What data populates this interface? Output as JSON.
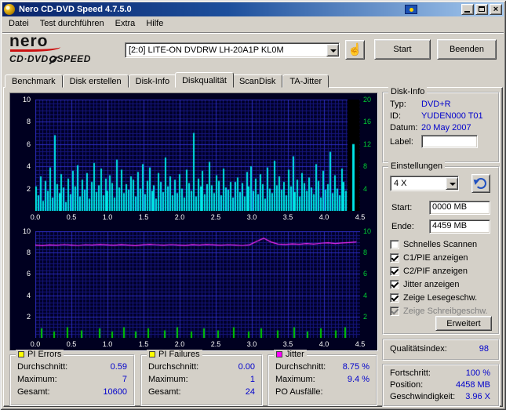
{
  "window": {
    "title": "Nero CD-DVD Speed 4.7.5.0"
  },
  "menu": {
    "items": [
      "Datei",
      "Test durchführen",
      "Extra",
      "Hilfe"
    ]
  },
  "toolbar": {
    "logo": {
      "line1": "nero",
      "line2_left": "CD·DVD",
      "line2_right": "SPEED"
    },
    "drive": "[2:0]  LITE-ON DVDRW LH-20A1P KL0M",
    "start": "Start",
    "quit": "Beenden"
  },
  "tabs": {
    "items": [
      "Benchmark",
      "Disk erstellen",
      "Disk-Info",
      "Diskqualität",
      "ScanDisk",
      "TA-Jitter"
    ],
    "active": "Diskqualität"
  },
  "disk_info": {
    "title": "Disk-Info",
    "rows": [
      {
        "label": "Typ:",
        "value": "DVD+R"
      },
      {
        "label": "ID:",
        "value": "YUDEN000 T01"
      },
      {
        "label": "Datum:",
        "value": "20 May 2007"
      },
      {
        "label": "Label:",
        "value": ""
      }
    ]
  },
  "settings": {
    "title": "Einstellungen",
    "speed_value": "4 X",
    "start_label": "Start:",
    "start_value": "0000 MB",
    "end_label": "Ende:",
    "end_value": "4459 MB",
    "checkboxes": [
      {
        "label": "Schnelles Scannen",
        "checked": false,
        "disabled": false
      },
      {
        "label": "C1/PIE anzeigen",
        "checked": true,
        "disabled": false
      },
      {
        "label": "C2/PIF anzeigen",
        "checked": true,
        "disabled": false
      },
      {
        "label": "Jitter anzeigen",
        "checked": true,
        "disabled": false
      },
      {
        "label": "Zeige Lesegeschw.",
        "checked": true,
        "disabled": false
      },
      {
        "label": "Zeige Schreibgeschw.",
        "checked": true,
        "disabled": true
      }
    ],
    "advanced": "Erweitert"
  },
  "quality_index": {
    "label": "Qualitätsindex:",
    "value": "98"
  },
  "progress": {
    "rows": [
      {
        "label": "Fortschritt:",
        "value": "100 %"
      },
      {
        "label": "Position:",
        "value": "4458 MB"
      },
      {
        "label": "Geschwindigkeit:",
        "value": "3.96 X"
      }
    ]
  },
  "stats": {
    "pi_errors": {
      "title": "PI Errors",
      "color": "#ffff00",
      "rows": [
        {
          "label": "Durchschnitt:",
          "value": "0.59"
        },
        {
          "label": "Maximum:",
          "value": "7"
        },
        {
          "label": "Gesamt:",
          "value": "10600"
        }
      ]
    },
    "pi_failures": {
      "title": "PI Failures",
      "color": "#ffff00",
      "rows": [
        {
          "label": "Durchschnitt:",
          "value": "0.00"
        },
        {
          "label": "Maximum:",
          "value": "1"
        },
        {
          "label": "Gesamt:",
          "value": "24"
        }
      ]
    },
    "jitter": {
      "title": "Jitter",
      "color": "#ff00ff",
      "rows": [
        {
          "label": "Durchschnitt:",
          "value": "8.75 %"
        },
        {
          "label": "Maximum:",
          "value": "9.4 %"
        },
        {
          "label": "PO Ausfälle:",
          "value": ""
        }
      ]
    }
  },
  "chart_data": [
    {
      "type": "bar",
      "title": "PI Errors vs. Disk-Position (GB)",
      "xlim": [
        0,
        4.5
      ],
      "ylim": [
        0,
        10
      ],
      "x_ticks": [
        "0.0",
        "0.5",
        "1.0",
        "1.5",
        "2.0",
        "2.5",
        "3.0",
        "3.5",
        "4.0",
        "4.5"
      ],
      "y_ticks_left": [
        "10",
        "8",
        "6",
        "4",
        "2"
      ],
      "y_ticks_right": [
        "20",
        "16",
        "12",
        "8",
        "4"
      ],
      "grid": {
        "bg": "#000026",
        "minor": "#16167d",
        "major": "#2b2bbd"
      },
      "bar_color": "#00e6e6",
      "bars_end_x": 4.33,
      "values": [
        2.2,
        1.4,
        3.1,
        0.9,
        2.7,
        1.8,
        3.9,
        1.2,
        6.8,
        2.4,
        1.6,
        3.3,
        2.1,
        0.8,
        2.9,
        1.5,
        3.6,
        2.2,
        4.1,
        1.3,
        2.8,
        1.9,
        3.4,
        1.1,
        2.6,
        4.3,
        1.7,
        2.3,
        3.8,
        1.4,
        2.9,
        1.8,
        3.2,
        2.5,
        1.2,
        4.6,
        2.1,
        3.7,
        1.6,
        2.4,
        1.9,
        3.1,
        2.8,
        1.3,
        3.5,
        2.0,
        4.2,
        1.5,
        2.7,
        3.9,
        1.8,
        2.3,
        1.1,
        3.4,
        2.6,
        1.7,
        4.8,
        2.2,
        3.1,
        1.4,
        2.8,
        1.6,
        3.3,
        2.0,
        1.2,
        3.7,
        2.5,
        1.8,
        7.0,
        1.3,
        2.9,
        2.2,
        3.6,
        1.5,
        2.4,
        4.4,
        2.3,
        1.6,
        3.2,
        2.7,
        1.4,
        3.8,
        2.1,
        1.9,
        2.6,
        1.2,
        2.6,
        3.0,
        1.7,
        2.5,
        1.3,
        3.5,
        2.2,
        4.0,
        1.8,
        2.9,
        1.5,
        3.3,
        2.4,
        1.1,
        3.9,
        2.0,
        1.6,
        4.5,
        2.3,
        3.1,
        1.9,
        2.6,
        1.4,
        3.7,
        2.2,
        4.9,
        1.7,
        2.8,
        1.3,
        3.4,
        2.5,
        1.8,
        3.0,
        2.1,
        1.5,
        4.2,
        2.7,
        1.2,
        3.6,
        1.9,
        2.4,
        5.3,
        1.6,
        3.2,
        2.0,
        1.4,
        3.8,
        2.6,
        1.8
      ],
      "tail": {
        "black_from": 4.33,
        "spike_x": 4.39,
        "spike_value": 6
      }
    },
    {
      "type": "bar+line",
      "title": "PI Failures und Jitter vs. Disk-Position (GB)",
      "xlim": [
        0,
        4.5
      ],
      "ylim": [
        0,
        10
      ],
      "x_ticks": [
        "0.0",
        "0.5",
        "1.0",
        "1.5",
        "2.0",
        "2.5",
        "3.0",
        "3.5",
        "4.0",
        "4.5"
      ],
      "y_ticks_left": [
        "10",
        "8",
        "6",
        "4",
        "2"
      ],
      "y_ticks_right": [
        "10",
        "8",
        "6",
        "4",
        "2"
      ],
      "grid": {
        "bg": "#000026",
        "minor": "#16167d",
        "major": "#2b2bbd"
      },
      "bar_color": "#00cc00",
      "line_color": "#ff2bff",
      "pif_spikes": [
        [
          0.08,
          0.9
        ],
        [
          0.25,
          0.6
        ],
        [
          0.44,
          1.0
        ],
        [
          0.63,
          0.7
        ],
        [
          0.88,
          0.9
        ],
        [
          1.05,
          0.6
        ],
        [
          1.22,
          1.0
        ],
        [
          1.38,
          0.6
        ],
        [
          1.55,
          0.9
        ],
        [
          1.78,
          0.7
        ],
        [
          1.96,
          1.0
        ],
        [
          2.15,
          0.6
        ],
        [
          2.33,
          0.9
        ],
        [
          2.52,
          0.7
        ],
        [
          2.74,
          1.0
        ],
        [
          2.95,
          0.6
        ],
        [
          3.12,
          0.9
        ],
        [
          3.35,
          0.7
        ],
        [
          3.58,
          1.0
        ],
        [
          3.76,
          0.6
        ],
        [
          3.95,
          0.9
        ],
        [
          4.15,
          0.7
        ],
        [
          4.28,
          1.0
        ]
      ],
      "jitter_x_end": 4.45,
      "jitter_values": [
        8.7,
        8.65,
        8.72,
        8.68,
        8.75,
        8.7,
        8.66,
        8.73,
        8.7,
        8.76,
        8.72,
        8.68,
        8.74,
        8.7,
        8.65,
        8.72,
        8.78,
        8.73,
        8.69,
        8.75,
        8.71,
        8.67,
        8.74,
        8.7,
        8.76,
        8.72,
        8.68,
        8.73,
        8.7,
        8.66,
        8.72,
        9.05,
        9.35,
        9.0,
        8.8,
        8.76,
        8.82,
        8.78,
        8.85,
        8.8,
        8.88,
        8.92,
        8.85,
        8.9,
        8.95,
        9.0
      ]
    }
  ]
}
